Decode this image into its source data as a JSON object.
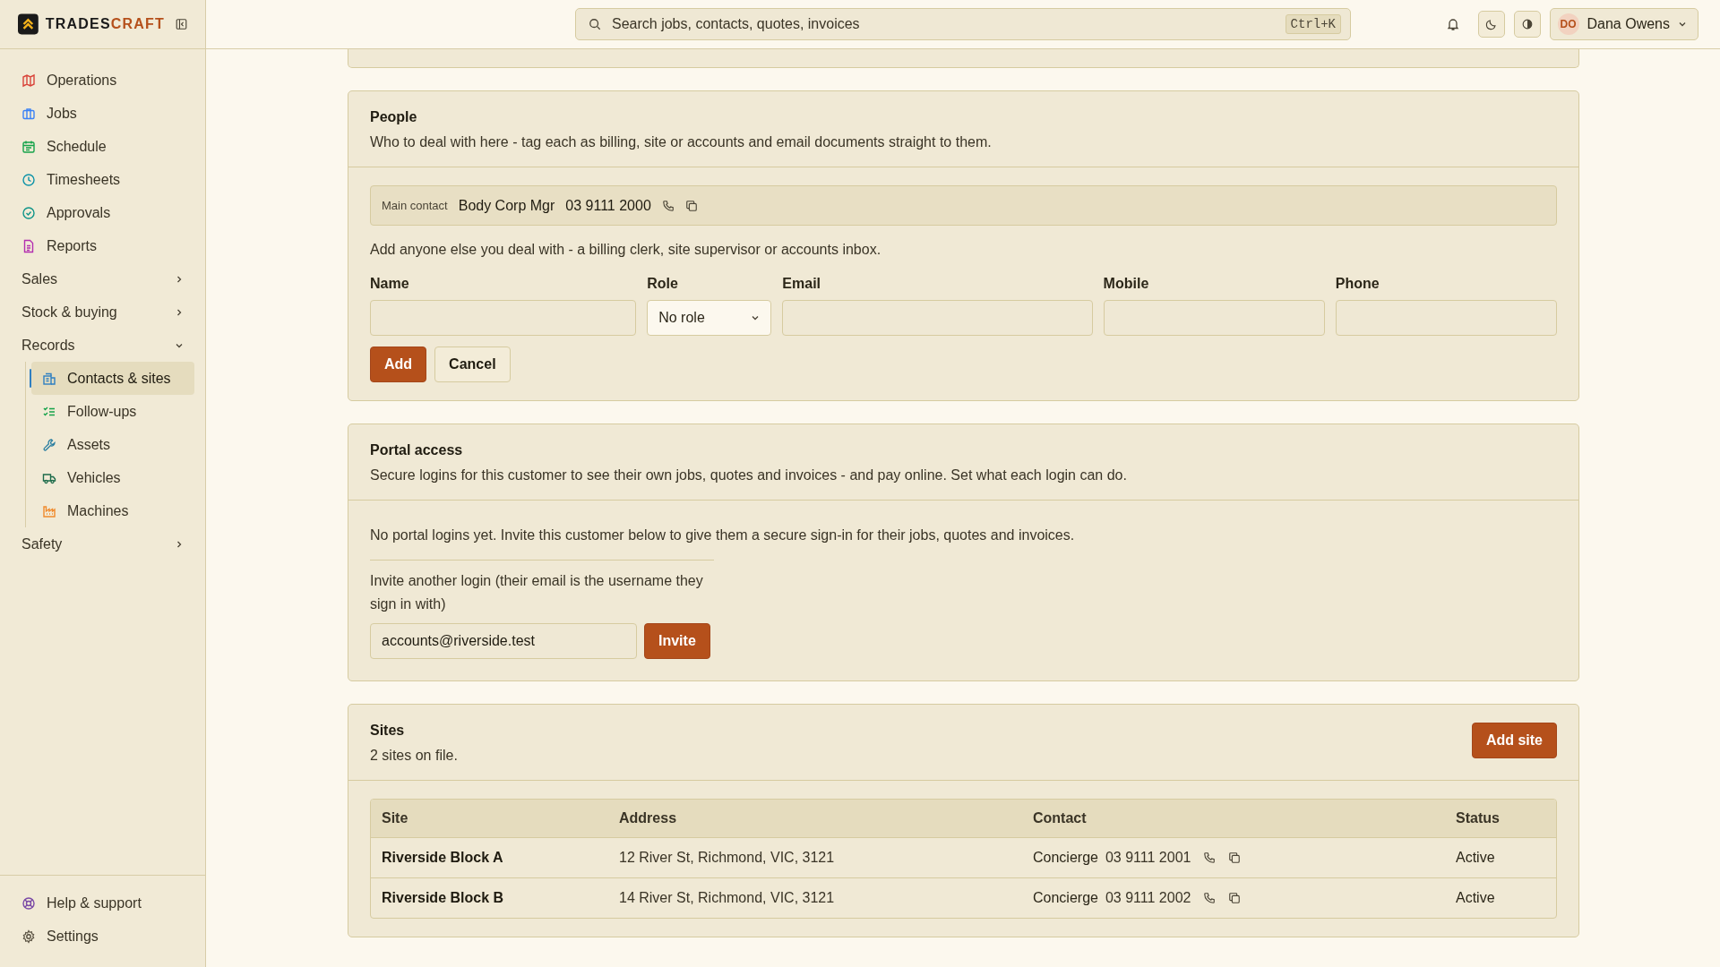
{
  "brand": {
    "part_1": "TRADES",
    "part_2": "CRAFT"
  },
  "sidebar": {
    "items": [
      {
        "kind": "link",
        "label": "Operations",
        "selected": false
      },
      {
        "kind": "link",
        "label": "Jobs",
        "selected": false
      },
      {
        "kind": "link",
        "label": "Schedule",
        "selected": false
      },
      {
        "kind": "link",
        "label": "Timesheets",
        "selected": false
      },
      {
        "kind": "link",
        "label": "Approvals",
        "selected": false
      },
      {
        "kind": "link",
        "label": "Reports",
        "selected": false
      },
      {
        "kind": "group",
        "label": "Sales",
        "expanded": false
      },
      {
        "kind": "group",
        "label": "Stock & buying",
        "expanded": false
      },
      {
        "kind": "group",
        "label": "Records",
        "expanded": true,
        "children": [
          {
            "label": "Contacts & sites",
            "selected": true
          },
          {
            "label": "Follow-ups",
            "selected": false
          },
          {
            "label": "Assets",
            "selected": false
          },
          {
            "label": "Vehicles",
            "selected": false
          },
          {
            "label": "Machines",
            "selected": false
          }
        ]
      },
      {
        "kind": "group",
        "label": "Safety",
        "expanded": false
      }
    ],
    "footer": [
      "Help & support",
      "Settings"
    ]
  },
  "header": {
    "search": {
      "placeholder": "Search jobs, contacts, quotes, invoices",
      "shortcut": "Ctrl+K"
    },
    "user": {
      "initials": "DO",
      "name": "Dana Owens"
    }
  },
  "people": {
    "title": "People",
    "description": "Who to deal with here - tag each as billing, site or accounts and email documents straight to them.",
    "main_contact": {
      "label": "Main contact",
      "name": "Body Corp Mgr",
      "phone": "03 9111 2000"
    },
    "hint": "Add anyone else you deal with - a billing clerk, site supervisor or accounts inbox.",
    "fields": [
      {
        "kind": "text",
        "label": "Name"
      },
      {
        "kind": "select",
        "label": "Role",
        "value": "No role"
      },
      {
        "kind": "text",
        "label": "Email"
      },
      {
        "kind": "text",
        "label": "Mobile"
      },
      {
        "kind": "text",
        "label": "Phone"
      }
    ],
    "buttons": [
      {
        "kind": "primary",
        "label": "Add"
      },
      {
        "kind": "secondary",
        "label": "Cancel"
      }
    ]
  },
  "portal": {
    "title": "Portal access",
    "description": "Secure logins for this customer to see their own jobs, quotes and invoices - and pay online. Set what each login can do.",
    "empty_note": "No portal logins yet. Invite this customer below to give them a secure sign-in for their jobs, quotes and invoices.",
    "invite_label": "Invite another login (their email is the username they sign in with)",
    "invite_value": "accounts@riverside.test",
    "button": "Invite"
  },
  "sites": {
    "title": "Sites",
    "count": "2 sites on file.",
    "button": "Add site",
    "columns": [
      "Site",
      "Address",
      "Contact",
      "Status"
    ],
    "rows": [
      {
        "site": "Riverside Block A",
        "address": "12 River St, Richmond, VIC, 3121",
        "contact": "Concierge",
        "phone": "03 9111 2001",
        "status": "Active"
      },
      {
        "site": "Riverside Block B",
        "address": "14 River St, Richmond, VIC, 3121",
        "contact": "Concierge",
        "phone": "03 9111 2002",
        "status": "Active"
      }
    ]
  }
}
